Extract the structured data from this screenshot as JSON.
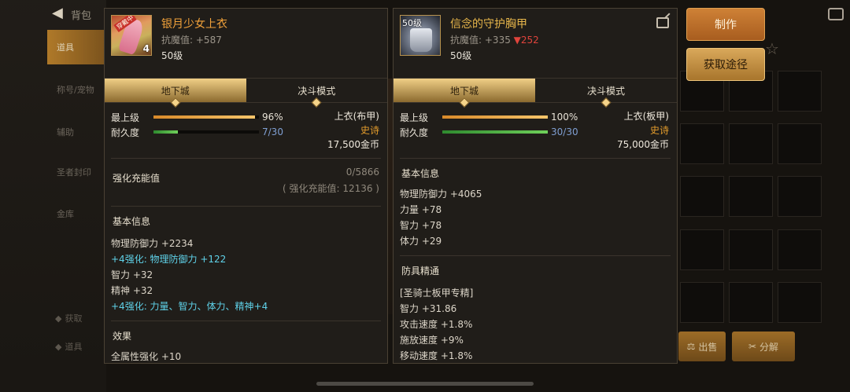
{
  "background": {
    "top_title": "背包",
    "tabs": [
      "道具",
      "称号/宠物",
      "辅助",
      "圣者封印",
      "金库"
    ],
    "active_tab": 0,
    "bottom_left": [
      "获取",
      "道具"
    ],
    "bottom_buttons": [
      "出售",
      "分解"
    ]
  },
  "left_panel": {
    "name": "银月少女上衣",
    "resist_label": "抗魔值:",
    "resist_value": "+587",
    "level": "50级",
    "thumb_tag": "穿戴中",
    "thumb_count": "4",
    "tabs": [
      "地下城",
      "决斗模式"
    ],
    "max_level_label": "最上级",
    "max_level_pct": "96%",
    "max_level_fill": 0.96,
    "durability_label": "耐久度",
    "durability_value": "7/30",
    "durability_fill": 0.233,
    "slot": "上衣(布甲)",
    "rarity": "史诗",
    "price": "17,500金币",
    "charge_title": "强化充能值",
    "charge_value": "0/5866",
    "charge_sub": "( 强化充能值: 12136 )",
    "basic_title": "基本信息",
    "basic_lines": [
      {
        "text": "物理防御力 +2234",
        "cyan": false
      },
      {
        "text": "+4强化: 物理防御力 +122",
        "cyan": true
      },
      {
        "text": "智力 +32",
        "cyan": false
      },
      {
        "text": "精神 +32",
        "cyan": false
      },
      {
        "text": "+4强化: 力量、智力、体力、精神+4",
        "cyan": true
      }
    ],
    "effect_title": "效果",
    "effect_line": "全属性强化 +10"
  },
  "right_panel": {
    "name": "信念的守护胸甲",
    "thumb_level": "50级",
    "resist_label": "抗魔值:",
    "resist_value": "+335",
    "resist_diff": "▼252",
    "level": "50级",
    "tabs": [
      "地下城",
      "决斗模式"
    ],
    "max_level_label": "最上级",
    "max_level_pct": "100%",
    "max_level_fill": 1.0,
    "durability_label": "耐久度",
    "durability_value": "30/30",
    "durability_fill": 1.0,
    "slot": "上衣(板甲)",
    "rarity": "史诗",
    "price": "75,000金币",
    "basic_title": "基本信息",
    "basic_lines": [
      "物理防御力 +4065",
      "力量 +78",
      "智力 +78",
      "体力 +29"
    ],
    "mastery_title": "防具精通",
    "mastery_lines": [
      "[圣骑士板甲专精]",
      "智力 +31.86",
      "攻击速度 +1.8%",
      "施放速度 +9%",
      "移动速度 +1.8%"
    ]
  },
  "actions": {
    "make": "制作",
    "source": "获取途径"
  }
}
